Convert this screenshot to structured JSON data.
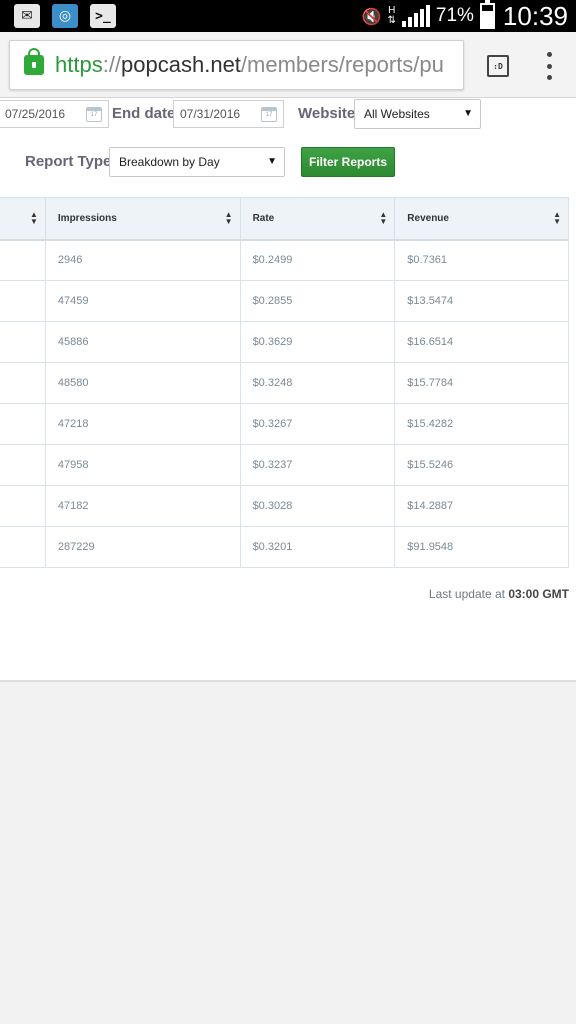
{
  "status_bar": {
    "battery_percent": "71%",
    "battery_level": 0.71,
    "network_type": "H",
    "time": "10:39",
    "icons": [
      "chat-icon",
      "gps-icon",
      "terminal-icon",
      "mute-icon",
      "signal-icon",
      "battery-icon"
    ]
  },
  "browser": {
    "url_scheme": "https",
    "url_sep": "://",
    "url_host": "popcash.net",
    "url_path": "/members/reports/pu",
    "tabs_label": ":D"
  },
  "filters": {
    "start_date": "07/25/2016",
    "end_date_label": "End date",
    "end_date": "07/31/2016",
    "website_label": "Website",
    "website_value": "All Websites",
    "report_type_label": "Report Type",
    "report_type_value": "Breakdown by Day",
    "filter_button": "Filter Reports"
  },
  "table": {
    "headers": [
      "",
      "Impressions",
      "Rate",
      "Revenue"
    ],
    "rows": [
      {
        "impressions": "2946",
        "rate": "$0.2499",
        "revenue": "$0.7361"
      },
      {
        "impressions": "47459",
        "rate": "$0.2855",
        "revenue": "$13.5474"
      },
      {
        "impressions": "45886",
        "rate": "$0.3629",
        "revenue": "$16.6514"
      },
      {
        "impressions": "48580",
        "rate": "$0.3248",
        "revenue": "$15.7784"
      },
      {
        "impressions": "47218",
        "rate": "$0.3267",
        "revenue": "$15.4282"
      },
      {
        "impressions": "47958",
        "rate": "$0.3237",
        "revenue": "$15.5246"
      },
      {
        "impressions": "47182",
        "rate": "$0.3028",
        "revenue": "$14.2887"
      },
      {
        "impressions": "287229",
        "rate": "$0.3201",
        "revenue": "$91.9548"
      }
    ]
  },
  "footer": {
    "last_update_prefix": "Last update at ",
    "last_update_time": "03:00 GMT"
  },
  "colors": {
    "accent_green": "#2faa3a",
    "button_green": "#3fa144",
    "url_green": "#2b9a38",
    "table_header_bg": "#eef3f7"
  }
}
